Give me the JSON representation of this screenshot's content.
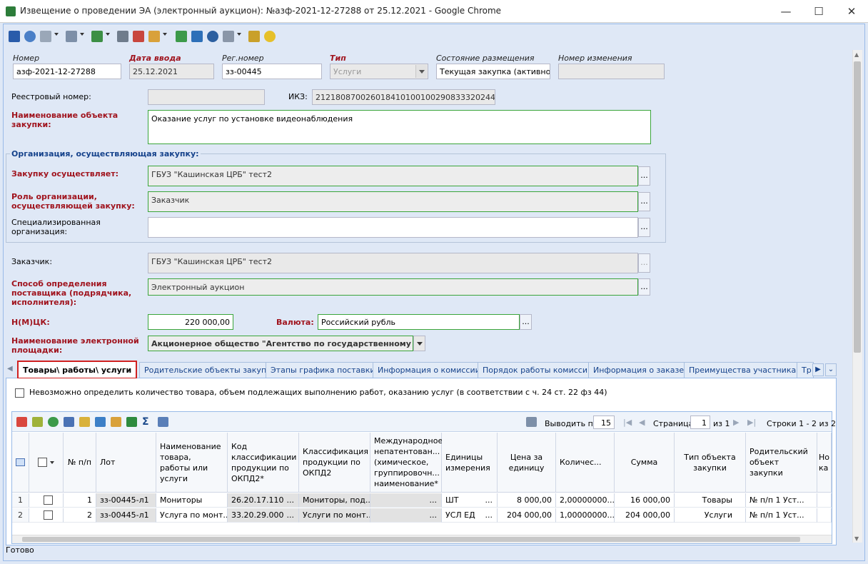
{
  "window": {
    "title": "Извещение о проведении ЭА (электронный аукцион): №азф-2021-12-27288 от 25.12.2021 - Google Chrome",
    "minimize": "—",
    "maximize": "☐",
    "close": "✕"
  },
  "form": {
    "nomer": {
      "label": "Номер",
      "value": "азф-2021-12-27288"
    },
    "data_vvoda": {
      "label": "Дата ввода",
      "value": "25.12.2021"
    },
    "reg_nomer": {
      "label": "Рег.номер",
      "value": "зз-00445"
    },
    "tip": {
      "label": "Тип",
      "value": "Услуги"
    },
    "sostoyanie": {
      "label": "Состояние размещения",
      "value": "Текущая закупка (активно)"
    },
    "nomer_izm": {
      "label": "Номер изменения",
      "value": ""
    },
    "reestr_nomer": {
      "label": "Реестровый номер:",
      "value": ""
    },
    "ikz": {
      "label": "ИКЗ:",
      "value": "212180870026018410100100290833320244"
    },
    "naimenovanie": {
      "label": "Наименование объекта закупки:",
      "value": "Оказание услуг по установке видеонаблюдения"
    },
    "org_section": "Организация, осуществляющая закупку:",
    "zakupku_osush": {
      "label": "Закупку осуществляет:",
      "value": "ГБУЗ \"Кашинская ЦРБ\" тест2"
    },
    "rol_org": {
      "label": "Роль организации, осуществляющей закупку:",
      "value": "Заказчик"
    },
    "spec_org": {
      "label": "Специализированная организация:",
      "value": ""
    },
    "zakazchik": {
      "label": "Заказчик:",
      "value": "ГБУЗ \"Кашинская ЦРБ\" тест2"
    },
    "sposob": {
      "label": "Способ определения поставщика (подрядчика, исполнителя):",
      "value": "Электронный аукцион"
    },
    "nmck": {
      "label": "Н(М)ЦК:",
      "value": "220 000,00"
    },
    "valyuta": {
      "label": "Валюта:",
      "value": "Российский рубль"
    },
    "ploshadka": {
      "label": "Наименование электронной площадки:",
      "value": "Акционерное общество \"Агентство по государственному заказу"
    },
    "dots": "..."
  },
  "tabs": [
    "Товары\\ работы\\ услуги",
    "Родительские объекты закупки",
    "Этапы графика поставки",
    "Информация о комиссии",
    "Порядок работы комиссии",
    "Информация о заказе",
    "Преимущества участникам",
    "Тр"
  ],
  "panel": {
    "checkbox_label": "Невозможно определить количество товара, объем подлежащих выполнению работ, оказанию услуг (в соответствии с ч. 24 ст. 22 фз 44)"
  },
  "grid": {
    "pager": {
      "vyvodit_po": "Выводить по",
      "page_size": "15",
      "stranica": "Страница",
      "page": "1",
      "iz": "из 1",
      "stroki": "Строки 1 - 2 из 2"
    },
    "columns": [
      "№ п/п",
      "Лот",
      "Наименование товара, работы или услуги",
      "Код классификации продукции по ОКПД2*",
      "Классификация продукции по ОКПД2",
      "Международное непатентован... (химическое, группировочн... наименование*",
      "Единицы измерения",
      "Цена за единицу",
      "Количес...",
      "Сумма",
      "Тип объекта закупки",
      "Родительский объект закупки",
      "Но ка"
    ],
    "rows": [
      {
        "rownum": "1",
        "np": "1",
        "lot": "зз-00445-л1",
        "name": "Мониторы",
        "okpd_code": "26.20.17.110",
        "okpd_class": "Мониторы, под...",
        "mnn": "",
        "unit": "ШТ",
        "price": "8 000,00",
        "qty": "2,00000000...",
        "sum": "16 000,00",
        "type": "Товары",
        "parent": "№ п/п 1 Уст..."
      },
      {
        "rownum": "2",
        "np": "2",
        "lot": "зз-00445-л1",
        "name": "Услуга по монт...",
        "okpd_code": "33.20.29.000",
        "okpd_class": "Услуги по монт...",
        "mnn": "",
        "unit": "УСЛ ЕД",
        "price": "204 000,00",
        "qty": "1,00000000...",
        "sum": "204 000,00",
        "type": "Услуги",
        "parent": "№ п/п 1 Уст..."
      }
    ],
    "dots": "..."
  },
  "status": "Готово",
  "colors": {
    "accent": "#15428b",
    "required": "#a0141e",
    "valid": "#3aa53a",
    "highlight": "#d02020"
  }
}
